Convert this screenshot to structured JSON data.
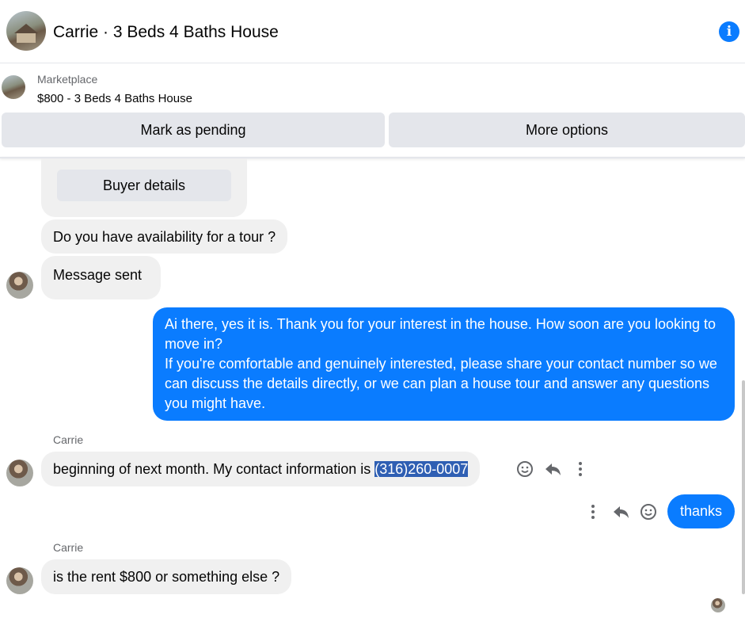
{
  "header": {
    "title": "Carrie · 3 Beds 4 Baths House",
    "info_icon": "info-icon"
  },
  "listing": {
    "source_label": "Marketplace",
    "listing_text": "$800 - 3 Beds 4 Baths House"
  },
  "actions": {
    "mark_pending": "Mark as pending",
    "more_options": "More options"
  },
  "messages": {
    "buyer_details_button": "Buyer details",
    "m1": "Do you have availability for a tour ?",
    "m2": "Message sent",
    "outgoing_line1": "Ai there, yes it is. Thank you for your interest in the house. How soon are you looking to move in?",
    "outgoing_line2": "If you're comfortable and genuinely interested, please share your contact number so we can discuss the details directly, or we can plan a house tour and answer any questions you might have.",
    "sender1": "Carrie",
    "m3_text": "beginning of next month. My contact information is ",
    "m3_highlight": "(316)260-0007",
    "thanks": "thanks",
    "sender2": "Carrie",
    "m4": "is the rent $800 or something else ?"
  },
  "colors": {
    "accent": "#0a7cff",
    "incoming_bubble": "#f0f0f0",
    "button_grey": "#e4e6eb",
    "selection": "#2f5fb3"
  }
}
